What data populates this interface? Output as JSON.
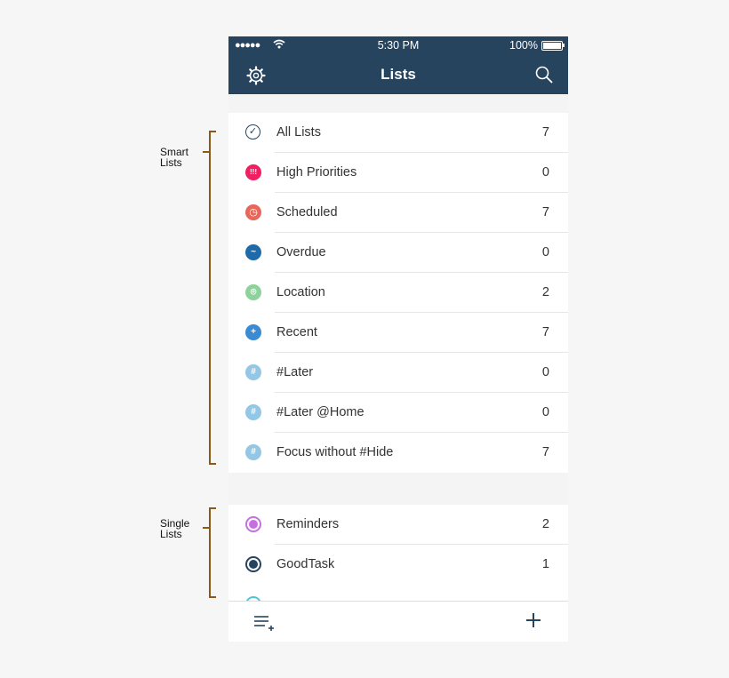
{
  "annotations": {
    "smart": [
      "Smart",
      "Lists"
    ],
    "single": [
      "Single",
      "Lists"
    ]
  },
  "status_bar": {
    "signal": "●●●●●",
    "time": "5:30 PM",
    "battery": "100%"
  },
  "header": {
    "title": "Lists"
  },
  "smart_lists": [
    {
      "label": "All Lists",
      "count": "7",
      "icon": "checkmark-icon",
      "color": "#ffffff",
      "glyph": "✓"
    },
    {
      "label": "High Priorities",
      "count": "0",
      "icon": "priority-icon",
      "color": "#ef1f61",
      "glyph": "!!!"
    },
    {
      "label": "Scheduled",
      "count": "7",
      "icon": "clock-icon",
      "color": "#e7675a",
      "glyph": "◷"
    },
    {
      "label": "Overdue",
      "count": "0",
      "icon": "overdue-icon",
      "color": "#1f6ba9",
      "glyph": "~"
    },
    {
      "label": "Location",
      "count": "2",
      "icon": "location-icon",
      "color": "#8ed29b",
      "glyph": "⌾"
    },
    {
      "label": "Recent",
      "count": "7",
      "icon": "recent-icon",
      "color": "#3b8ad4",
      "glyph": "+"
    },
    {
      "label": "#Later",
      "count": "0",
      "icon": "hashtag-icon",
      "color": "#94c7e6",
      "glyph": "#"
    },
    {
      "label": "#Later @Home",
      "count": "0",
      "icon": "hashtag-icon",
      "color": "#94c7e6",
      "glyph": "#"
    },
    {
      "label": "Focus without #Hide",
      "count": "7",
      "icon": "hashtag-icon",
      "color": "#94c7e6",
      "glyph": "#"
    }
  ],
  "single_lists": [
    {
      "label": "Reminders",
      "count": "2",
      "icon": "reminders-dot-icon",
      "color": "#c76ee0"
    },
    {
      "label": "GoodTask",
      "count": "1",
      "icon": "goodtask-dot-icon",
      "color": "#27445f"
    }
  ],
  "colors": {
    "navbar": "#27445f",
    "bracket": "#8a5a1c"
  }
}
